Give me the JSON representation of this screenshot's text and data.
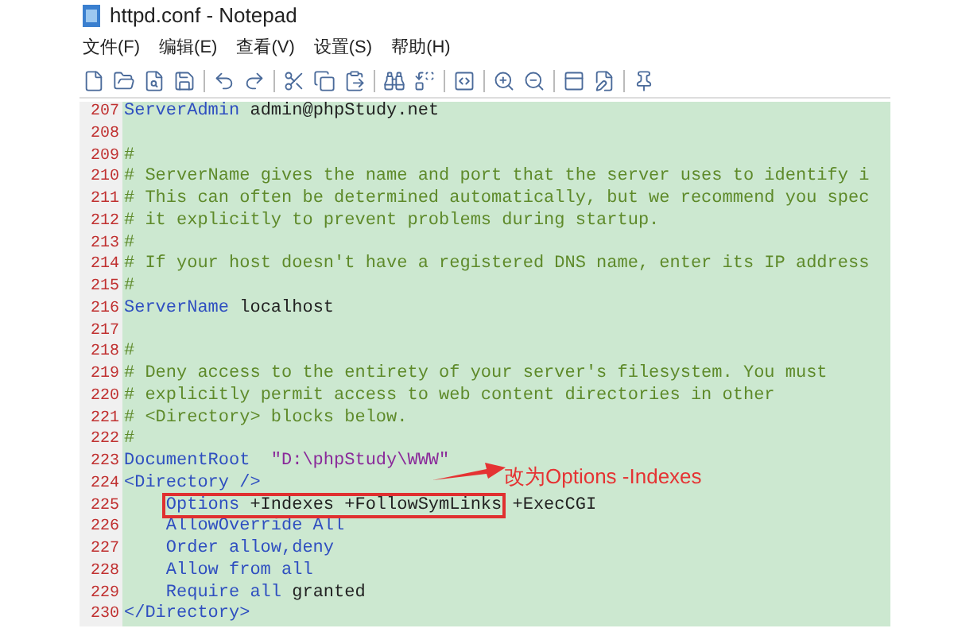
{
  "window": {
    "title": "httpd.conf - Notepad"
  },
  "menu": [
    "文件(F)",
    "编辑(E)",
    "查看(V)",
    "设置(S)",
    "帮助(H)"
  ],
  "lines": [
    {
      "number": "207",
      "segments": [
        {
          "kind": "keyword",
          "text": "ServerAdmin"
        },
        {
          "kind": "plain",
          "text": " admin@phpStudy.net"
        }
      ]
    },
    {
      "number": "208"
    },
    {
      "number": "209",
      "segments": [
        {
          "kind": "comment",
          "text": "#"
        }
      ]
    },
    {
      "number": "210",
      "segments": [
        {
          "kind": "comment",
          "text": "# ServerName gives the name and port that the server uses to identify i"
        }
      ]
    },
    {
      "number": "211",
      "segments": [
        {
          "kind": "comment",
          "text": "# This can often be determined automatically, but we recommend you spec"
        }
      ]
    },
    {
      "number": "212",
      "segments": [
        {
          "kind": "comment",
          "text": "# it explicitly to prevent problems during startup."
        }
      ]
    },
    {
      "number": "213",
      "segments": [
        {
          "kind": "comment",
          "text": "#"
        }
      ]
    },
    {
      "number": "214",
      "segments": [
        {
          "kind": "comment",
          "text": "# If your host doesn't have a registered DNS name, enter its IP address"
        }
      ]
    },
    {
      "number": "215",
      "segments": [
        {
          "kind": "comment",
          "text": "#"
        }
      ]
    },
    {
      "number": "216",
      "segments": [
        {
          "kind": "keyword",
          "text": "ServerName"
        },
        {
          "kind": "plain",
          "text": " localhost"
        }
      ]
    },
    {
      "number": "217"
    },
    {
      "number": "218",
      "segments": [
        {
          "kind": "comment",
          "text": "#"
        }
      ]
    },
    {
      "number": "219",
      "segments": [
        {
          "kind": "comment",
          "text": "# Deny access to the entirety of your server's filesystem. You must"
        }
      ]
    },
    {
      "number": "220",
      "segments": [
        {
          "kind": "comment",
          "text": "# explicitly permit access to web content directories in other"
        }
      ]
    },
    {
      "number": "221",
      "segments": [
        {
          "kind": "comment",
          "text": "# <Directory> blocks below."
        }
      ]
    },
    {
      "number": "222",
      "segments": [
        {
          "kind": "comment",
          "text": "#"
        }
      ]
    },
    {
      "number": "223",
      "segments": [
        {
          "kind": "keyword",
          "text": "DocumentRoot"
        },
        {
          "kind": "string",
          "text": "\"D:\\phpStudy\\WWW\""
        }
      ]
    },
    {
      "number": "224",
      "segments": [
        {
          "kind": "keyword",
          "text": "<Directory />"
        }
      ]
    },
    {
      "number": "225",
      "indent": true,
      "segments": [
        {
          "kind": "group",
          "boxed": true,
          "segments": [
            {
              "kind": "keyword",
              "text": "Options"
            },
            {
              "kind": "plain",
              "text": " +Indexes +FollowSymLinks"
            }
          ]
        },
        {
          "kind": "plain",
          "text": " +ExecCGI"
        }
      ]
    },
    {
      "number": "226",
      "indent": true,
      "segments": [
        {
          "kind": "keyword",
          "text": "AllowOverride All"
        }
      ]
    },
    {
      "number": "227",
      "indent": true,
      "segments": [
        {
          "kind": "keyword",
          "text": "Order allow,deny"
        }
      ]
    },
    {
      "number": "228",
      "indent": true,
      "segments": [
        {
          "kind": "keyword",
          "text": "Allow from all"
        }
      ]
    },
    {
      "number": "229",
      "indent": true,
      "segments": [
        {
          "kind": "keyword",
          "text": "Require all"
        },
        {
          "kind": "plain",
          "text": " granted"
        }
      ]
    },
    {
      "number": "230",
      "segments": [
        {
          "kind": "keyword",
          "text": "</Directory>"
        }
      ]
    }
  ],
  "annotation": {
    "text": "改为Options -Indexes"
  }
}
